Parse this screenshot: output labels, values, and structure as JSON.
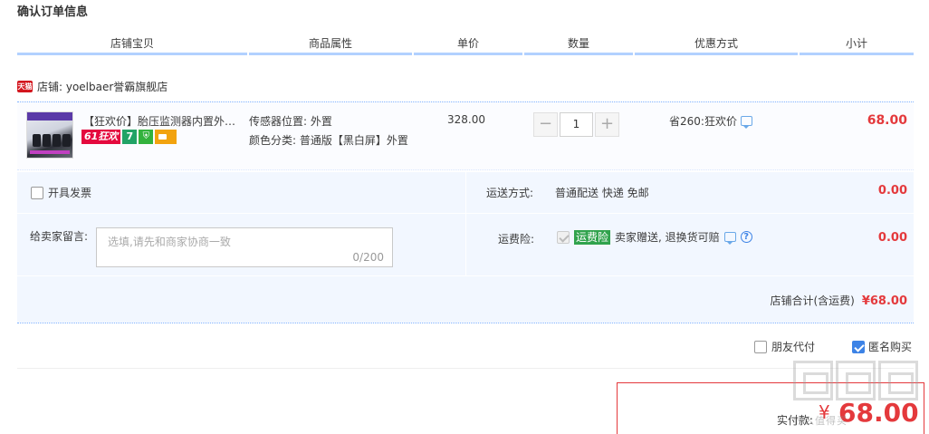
{
  "page": {
    "title": "确认订单信息"
  },
  "columns": [
    "店铺宝贝",
    "商品属性",
    "单价",
    "数量",
    "优惠方式",
    "小计"
  ],
  "shop": {
    "badge": "天猫",
    "label": "店铺: yoelbaer誉霸旗舰店"
  },
  "item": {
    "title": "【狂欢价】胎压监测器内置外置无线高精度汽车轮胎检测太阳能",
    "tags": {
      "promo": "61狂欢",
      "days": "7"
    },
    "attr_sensor": "传感器位置: 外置",
    "attr_color": "颜色分类: 普通版【黑白屏】外置",
    "price": "328.00",
    "quantity": "1",
    "decrease_symbol": "−",
    "increase_symbol": "+",
    "discount": "省260:狂欢价",
    "subtotal": "68.00"
  },
  "options": {
    "invoice_label": "开具发票",
    "message_label": "给卖家留言:",
    "message_placeholder": "选填,请先和商家协商一致",
    "message_count": "0/200",
    "shipping_label": "运送方式:",
    "shipping_value": "普通配送 快递 免邮",
    "shipping_fee": "0.00",
    "insurance_label": "运费险:",
    "insurance_tag": "运费险",
    "insurance_text": "卖家赠送, 退换货可赔",
    "insurance_fee": "0.00",
    "shop_total_label": "店铺合计(含运费)",
    "shop_total_value": "¥68.00"
  },
  "extras": {
    "friend_pay": "朋友代付",
    "anonymous": "匿名购买"
  },
  "payment": {
    "label": "实付款:",
    "symbol": "¥",
    "value": "68.00"
  },
  "watermark": {
    "text": "什么值得买"
  }
}
